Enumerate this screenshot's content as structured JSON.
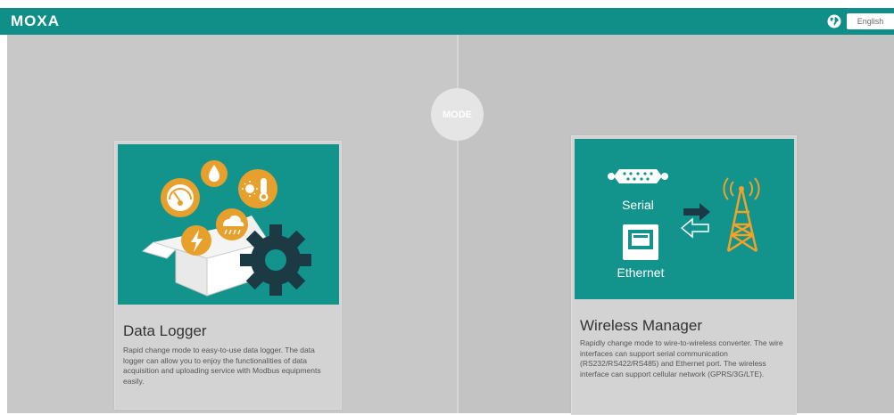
{
  "header": {
    "logo": "MOXA",
    "language": "English",
    "icons": {
      "globe": "globe-icon"
    }
  },
  "mode_label": "MODE",
  "cards": [
    {
      "title": "Data Logger",
      "description": "Rapid change mode to easy-to-use data logger. The data logger can allow you to enjoy the functionalities of data acquisition and uploading service with Modbus equipments easily.",
      "icons": [
        "open-box-icon",
        "gauge-icon",
        "water-drop-icon",
        "temperature-icon",
        "lightning-icon",
        "rain-cloud-icon",
        "gear-icon"
      ]
    },
    {
      "title": "Wireless Manager",
      "description": "Rapidly change mode to wire-to-wireless converter. The wire interfaces can support serial communication (RS232/RS422/RS485) and Ethernet port. The wireless interface can support cellular network (GPRS/3G/LTE).",
      "serial_label": "Serial",
      "ethernet_label": "Ethernet",
      "icons": [
        "serial-port-icon",
        "ethernet-port-icon",
        "exchange-arrows-icon",
        "cell-tower-icon"
      ]
    }
  ],
  "colors": {
    "brand_teal": "#0f8f88",
    "card_teal": "#12938b",
    "icon_orange": "#e8a02c",
    "gear_dark": "#1c3a44",
    "tower_orange": "#f2a227"
  }
}
